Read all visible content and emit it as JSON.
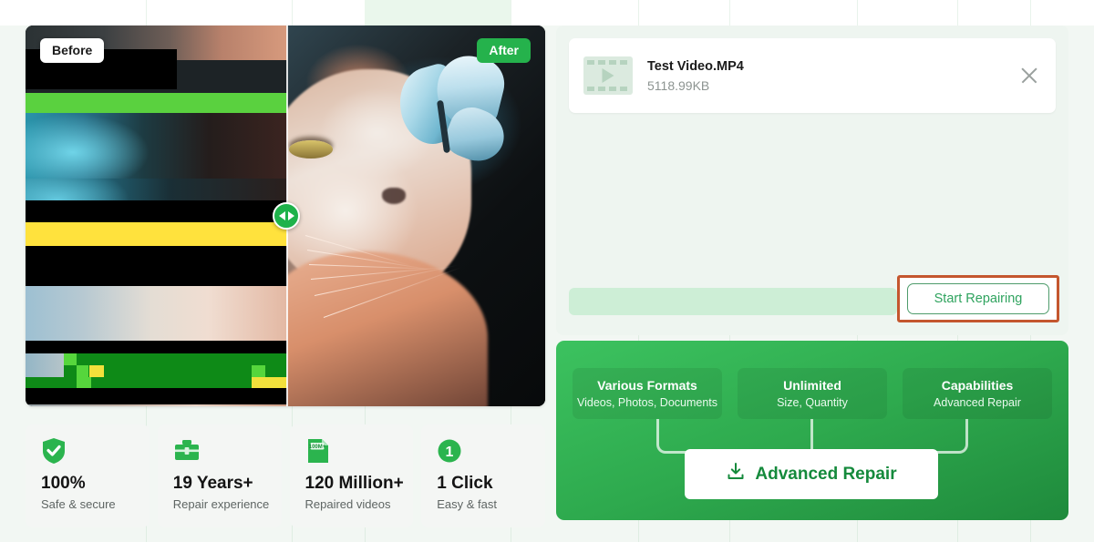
{
  "theme": {
    "brand_green": "#25b24c",
    "panel_green_start": "#3cc25f",
    "panel_green_end": "#1f8a3c",
    "page_bg": "#f2f7f3",
    "highlight_orange": "#c4562e",
    "progress_track": "#cdeed6"
  },
  "comparison": {
    "before_label": "Before",
    "after_label": "After",
    "handle_icon": "drag-left-right-icon",
    "before_image_alt": "glitched corrupted video frame of a cat",
    "after_image_alt": "repaired video frame of a cat with a butterfly on its nose"
  },
  "stats": [
    {
      "icon": "shield-check-icon",
      "value": "100%",
      "label": "Safe & secure"
    },
    {
      "icon": "toolbox-icon",
      "value": "19 Years+",
      "label": "Repair experience"
    },
    {
      "icon": "file-100m-icon",
      "value": "120 Million+",
      "label": "Repaired videos",
      "icon_text": "100M+"
    },
    {
      "icon": "number-one-circle-icon",
      "value": "1 Click",
      "label": "Easy & fast",
      "icon_text": "1"
    }
  ],
  "upload": {
    "file": {
      "thumbnail_icon": "video-film-icon",
      "name": "Test Video.MP4",
      "size": "5118.99KB",
      "remove_icon": "close-icon"
    },
    "progress": {
      "value": 0
    },
    "start_button": {
      "label": "Start Repairing"
    }
  },
  "features": {
    "cards": [
      {
        "title": "Various Formats",
        "subtitle": "Videos, Photos, Documents"
      },
      {
        "title": "Unlimited",
        "subtitle": "Size, Quantity"
      },
      {
        "title": "Capabilities",
        "subtitle": "Advanced Repair"
      }
    ],
    "cta": {
      "icon": "download-icon",
      "label": "Advanced Repair"
    }
  }
}
